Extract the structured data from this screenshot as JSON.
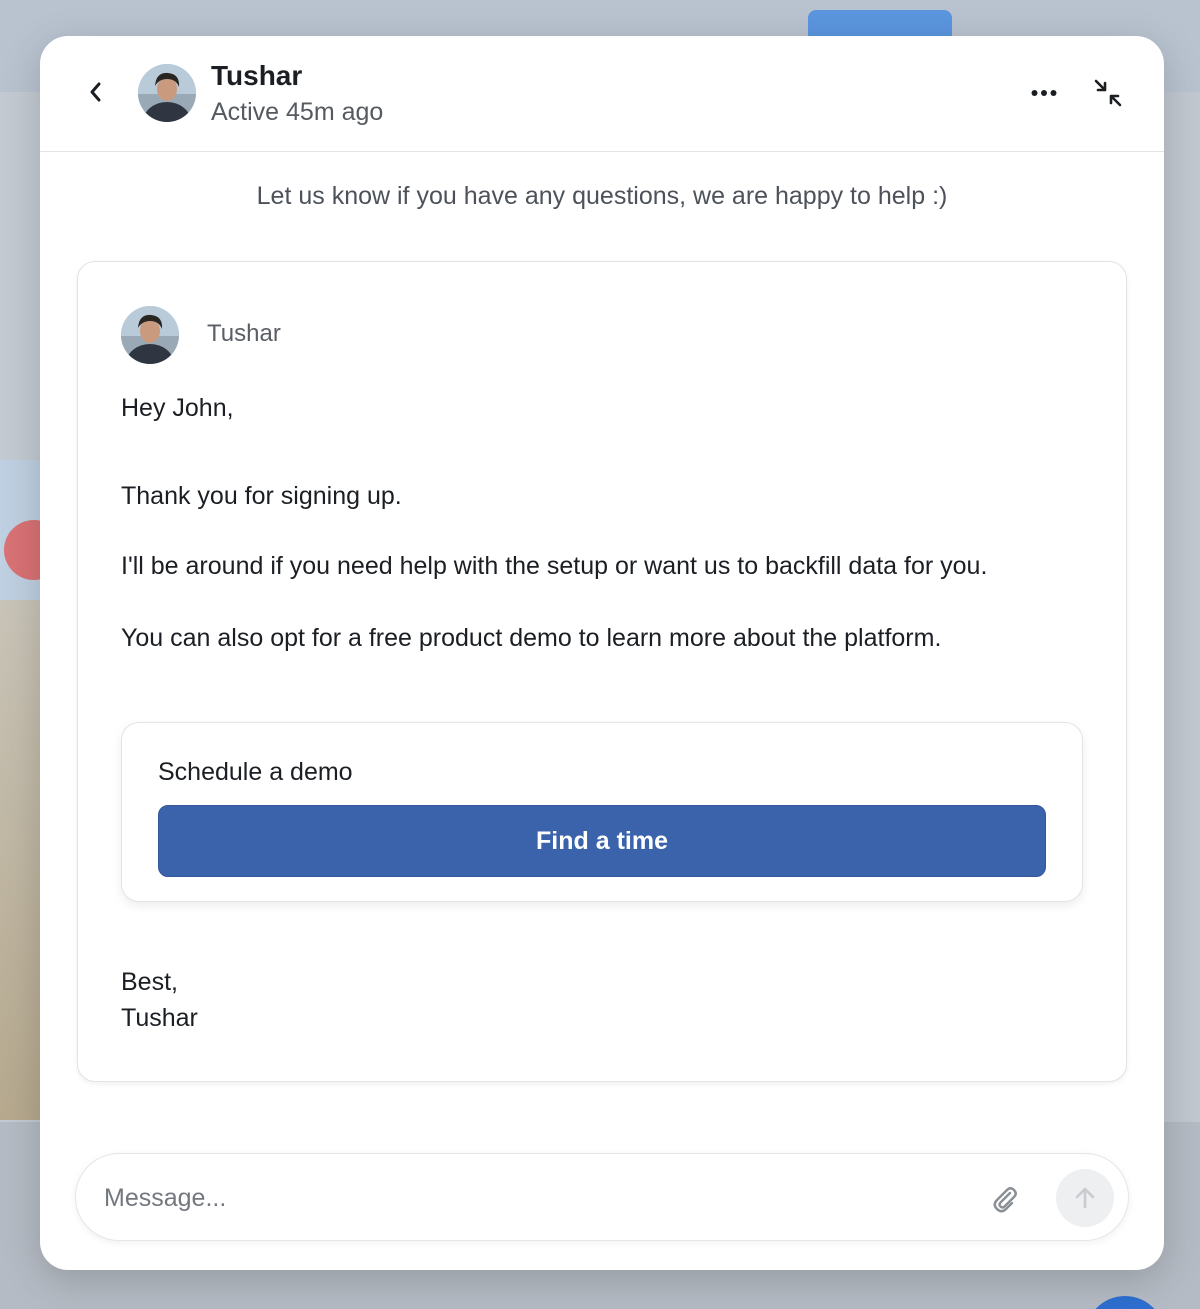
{
  "header": {
    "name": "Tushar",
    "status": "Active 45m ago",
    "back_icon": "chevron-left-icon",
    "more_icon": "more-horizontal-icon",
    "collapse_icon": "collapse-arrows-icon"
  },
  "intro": {
    "text": "Let us know if you have any questions, we are happy to help :)"
  },
  "message": {
    "sender": "Tushar",
    "greeting": "Hey John,",
    "lines": [
      "Thank you for signing up.",
      "I'll be around if you need help with the setup or want us to backfill data for you.",
      "You can also opt for a free product demo to learn more about the platform."
    ],
    "demo": {
      "title": "Schedule a demo",
      "button_label": "Find a time"
    },
    "signoff": "Best,",
    "signature": "Tushar"
  },
  "composer": {
    "placeholder": "Message...",
    "attach_icon": "paperclip-icon",
    "send_icon": "arrow-up-icon"
  },
  "colors": {
    "accent": "#3b63ab",
    "text": "#1b1f24",
    "muted": "#555a61",
    "border": "#e1e3e7"
  }
}
